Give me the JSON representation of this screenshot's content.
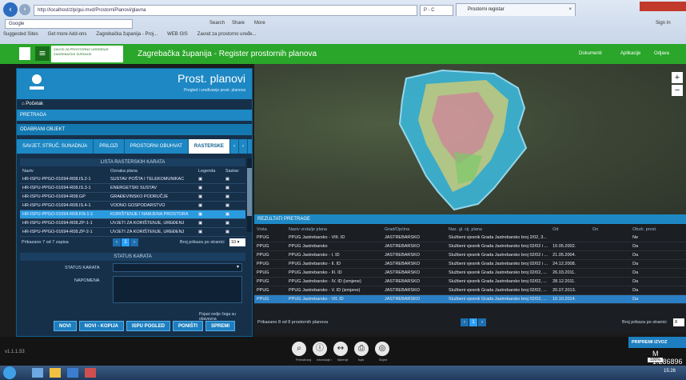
{
  "browser": {
    "url": "http://localhost/zlp/gui.mvd/ProstorniPlanovi/glavna",
    "search_hint": "P - C",
    "tab_title": "Prostorni registar",
    "search_engine": "Google",
    "toolbar_search": "Search",
    "toolbar_share": "Share",
    "toolbar_more": "More",
    "signin": "Sign In",
    "bookmarks": [
      "Suggested Sites",
      "Get more Add-ons",
      "Zagrebačka županija - Proj...",
      "WEB GIS",
      "Zavod za prostorno uređe..."
    ]
  },
  "app": {
    "logo_line1": "ZAVOD ZA PROSTORNO UREĐENJE",
    "logo_line2": "ZAGREBAČKE ŽUPANIJE",
    "title": "Zagrebačka županija - Register prostornih planova",
    "nav": [
      "Dokumenti",
      "Aplikacije",
      "Odjava"
    ]
  },
  "panel": {
    "title": "Prost. planovi",
    "subtitle": "Pregled i uređivanje prost. planova",
    "home_label": "Početak",
    "search_label": "PRETRAGA",
    "selected_object_label": "ODABRANI OBJEKT",
    "tabs": [
      "SAVJET. STRUČ. SUNADNJA",
      "PRILOZI",
      "PROSTORNI OBUHVAT",
      "RASTERSKE"
    ],
    "table_title": "LISTA RASTERSKIH KARATA",
    "columns": [
      "Naziv",
      "Oznaka plana",
      "Legenda",
      "Sastav"
    ],
    "rows": [
      {
        "naziv": "HR-ISPU-PPGO-01694-R08.IS.2-1",
        "oznaka": "SUSTAV POŠTA I TELEKOMUNIKAC"
      },
      {
        "naziv": "HR-ISPU-PPGO-01694-R08.IS.3-1",
        "oznaka": "ENERGETSKI SUSTAV"
      },
      {
        "naziv": "HR-ISPU-PPGO-01694-R08.GP",
        "oznaka": "GRAĐEVINSKO PODRUČJE"
      },
      {
        "naziv": "HR-ISPU-PPGO-01694-R08.IS.4-1",
        "oznaka": "VODNO GOSPODARSTVO"
      },
      {
        "naziv": "HR-ISPU-PPGO-01694-R08.KN-1-1",
        "oznaka": "KORIŠTENJE I NAMJENA PROSTORA",
        "selected": true
      },
      {
        "naziv": "HR-ISPU-PPGO-01694-R08.ZP-1-1",
        "oznaka": "UVJETI ZA KORIŠTENJE, UREĐENJ"
      },
      {
        "naziv": "HR-ISPU-PPGO-01694-R08.ZP-2-1",
        "oznaka": "UVJETI ZA KORIŠTENJE, UREĐENJ"
      }
    ],
    "shown_text": "Prikazano 7 od 7 zapisa",
    "page_current": "1",
    "per_page_label": "Broj prikaza po stranici",
    "per_page_value": "10",
    "status_title": "STATUS KARATA",
    "status_label": "STATUS KARATA",
    "note_label": "NAPOMENA",
    "footer_hint": "Pojasi ovdje čega su obavezna",
    "buttons": [
      "NOVI",
      "NOVI - KOPIJA",
      "ISPU POGLED",
      "PONIŠTI",
      "SPREMI"
    ]
  },
  "map": {
    "zoom_in": "+",
    "zoom_out": "−"
  },
  "results": {
    "title": "REZULTATI PRETRAGE",
    "columns": [
      "Vrsta",
      "Naziv vrsta/je plana",
      "Grad/Općina",
      "Naz. gl. cij. plana",
      "Od",
      "Do",
      "Obuh. prost."
    ],
    "rows": [
      {
        "vrsta": "PPUG",
        "naziv": "PPUG Jastrebarsko - VIII. ID",
        "grad": "JASTREBARSKO",
        "glasilo": "Službeni vjesnik Grada Jastrebarsko broj 2/02, 3...",
        "od": "",
        "do": "",
        "obuhvat": "Ne"
      },
      {
        "vrsta": "PPUG",
        "naziv": "PPUG Jastrebarsko",
        "grad": "JASTREBARSKO",
        "glasilo": "Službeni vjesnik Grada Jastrebarsko broj 02/02 i ...",
        "od": "10.05.2002.",
        "do": "",
        "obuhvat": "Da"
      },
      {
        "vrsta": "PPUG",
        "naziv": "PPUG Jastrebarsko - I. ID",
        "grad": "JASTREBARSKO",
        "glasilo": "Službeni vjesnik Grada Jastrebarsko broj 02/02 i ...",
        "od": "21.05.2004.",
        "do": "",
        "obuhvat": "Da"
      },
      {
        "vrsta": "PPUG",
        "naziv": "PPUG Jastrebarsko - II. ID",
        "grad": "JASTREBARSKO",
        "glasilo": "Službeni vjesnik Grada Jastrebarsko broj 02/02 i ...",
        "od": "24.12.2008.",
        "do": "",
        "obuhvat": "Da"
      },
      {
        "vrsta": "PPUG",
        "naziv": "PPUG Jastrebarsko - III. ID",
        "grad": "JASTREBARSKO",
        "glasilo": "Službeni vjesnik Grada Jastrebarsko broj 02/02, ...",
        "od": "26.03.2011.",
        "do": "",
        "obuhvat": "Da"
      },
      {
        "vrsta": "PPUG",
        "naziv": "PPUG Jastrebarsko - IV. ID (izmjene)",
        "grad": "JASTREBARSKO",
        "glasilo": "Službeni vjesnik Grada Jastrebarsko broj 02/02, ...",
        "od": "28.12.2011.",
        "do": "",
        "obuhvat": "Da"
      },
      {
        "vrsta": "PPUG",
        "naziv": "PPUG Jastrebarsko - V. ID (izmjene)",
        "grad": "JASTREBARSKO",
        "glasilo": "Službeni vjesnik Grada Jastrebarsko broj 02/02, ...",
        "od": "20.07.2013.",
        "do": "",
        "obuhvat": "Da"
      },
      {
        "vrsta": "PPUG",
        "naziv": "PPUG Jastrebarsko - VII. ID",
        "grad": "JASTREBARSKO",
        "glasilo": "Službeni vjesnik Grada Jastrebarsko broj 02/02, ...",
        "od": "10.10.2014.",
        "do": "",
        "obuhvat": "Da",
        "selected": true
      }
    ],
    "shown_text": "Prikazano 8 od 8 prostornih planova",
    "page_current": "1",
    "per_page_label": "Broj prikaza po stranici",
    "per_page_value": "8",
    "prepare_button": "PRIPREMI IZVOZ"
  },
  "footer": {
    "version": "v1.1.1.53",
    "scale": "M 1:286896",
    "tools": [
      "Pretraživanje",
      "Informacije o planu",
      "Mjerenje",
      "Ispis",
      "Slojevi"
    ]
  },
  "status": {
    "zoom": "100%",
    "clock": "15:26"
  },
  "colors": {
    "header_green": "#2aa62a",
    "accent_blue": "#1d88c4",
    "selected_row": "#2b9be0"
  }
}
